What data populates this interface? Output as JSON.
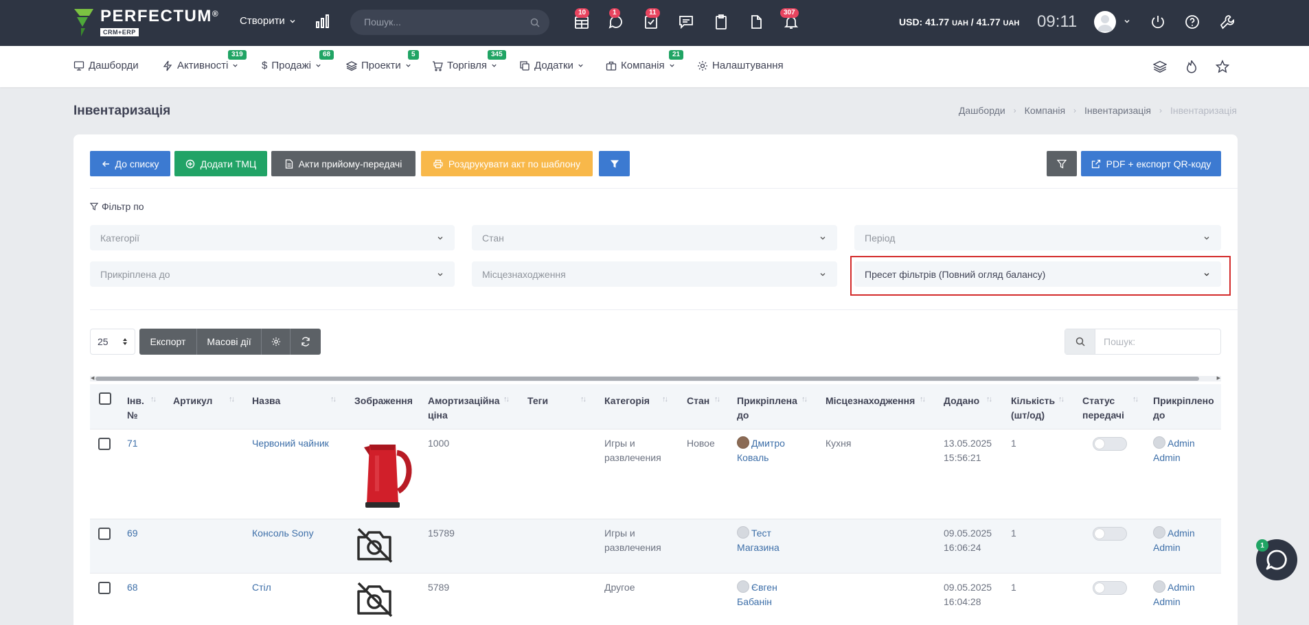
{
  "brand": {
    "name": "PERFECTUM",
    "reg": "®",
    "sub": "CRM+ERP"
  },
  "topbar": {
    "create_label": "Створити",
    "search_placeholder": "Пошук...",
    "badges": {
      "calendar": "10",
      "chat": "1",
      "tasks": "11",
      "notifications": "307"
    },
    "rate_prefix": "USD: ",
    "rate_value1": "41.77",
    "rate_unit": "UAH",
    "rate_sep": " / ",
    "rate_value2": "41.77",
    "time": "09:11"
  },
  "nav": {
    "items": [
      {
        "label": "Дашборди"
      },
      {
        "label": "Активності",
        "badge": "319"
      },
      {
        "label": "Продажі",
        "badge": "68"
      },
      {
        "label": "Проекти",
        "badge": "5"
      },
      {
        "label": "Торгівля",
        "badge": "345"
      },
      {
        "label": "Додатки"
      },
      {
        "label": "Компанія",
        "badge": "21"
      },
      {
        "label": "Налаштування"
      }
    ]
  },
  "page": {
    "title": "Інвентаризація",
    "breadcrumb": [
      "Дашборди",
      "Компанія",
      "Інвентаризація",
      "Інвентаризація"
    ]
  },
  "toolbar": {
    "back_label": "До списку",
    "add_label": "Додати ТМЦ",
    "acts_label": "Акти прийому-передачі",
    "print_label": "Роздрукувати акт по шаблону",
    "pdf_label": "PDF + експорт QR-коду"
  },
  "filters": {
    "title": "Фільтр по",
    "categories": "Категорії",
    "state": "Стан",
    "period": "Період",
    "attached": "Прикріплена до",
    "location": "Місцезнаходження",
    "preset": "Пресет фільтрів (Повний огляд балансу)"
  },
  "table_controls": {
    "per_page": "25",
    "export": "Експорт",
    "mass": "Масові дії",
    "search_placeholder": "Пошук:"
  },
  "columns": {
    "inv": "Інв. №",
    "article": "Артикул",
    "name": "Назва",
    "image": "Зображення",
    "amort": "Амортизаційна ціна",
    "tags": "Теги",
    "category": "Категорія",
    "state": "Стан",
    "attached": "Прикріплена до",
    "location": "Місцезнаходження",
    "added": "Додано",
    "qty": "Кількість (шт/од)",
    "transfer": "Статус передачі",
    "attached2": "Прикріплено до"
  },
  "rows": [
    {
      "inv": "71",
      "name": "Червоний чайник",
      "price": "1000",
      "category": "Игры и развлечения",
      "state": "Новое",
      "person": "Дмитро Коваль",
      "location": "Кухня",
      "date": "13.05.2025",
      "time": "15:56:21",
      "qty": "1",
      "admin": "Admin Admin"
    },
    {
      "inv": "69",
      "name": "Консоль Sony",
      "price": "15789",
      "category": "Игры и развлечения",
      "state": "",
      "person": "Тест Магазина",
      "location": "",
      "date": "09.05.2025",
      "time": "16:06:24",
      "qty": "1",
      "admin": "Admin Admin"
    },
    {
      "inv": "68",
      "name": "Стіл",
      "price": "5789",
      "category": "Другое",
      "state": "",
      "person": "Євген Бабанін",
      "location": "",
      "date": "09.05.2025",
      "time": "16:04:28",
      "qty": "1",
      "admin": "Admin Admin"
    }
  ],
  "chat": {
    "badge": "1"
  }
}
